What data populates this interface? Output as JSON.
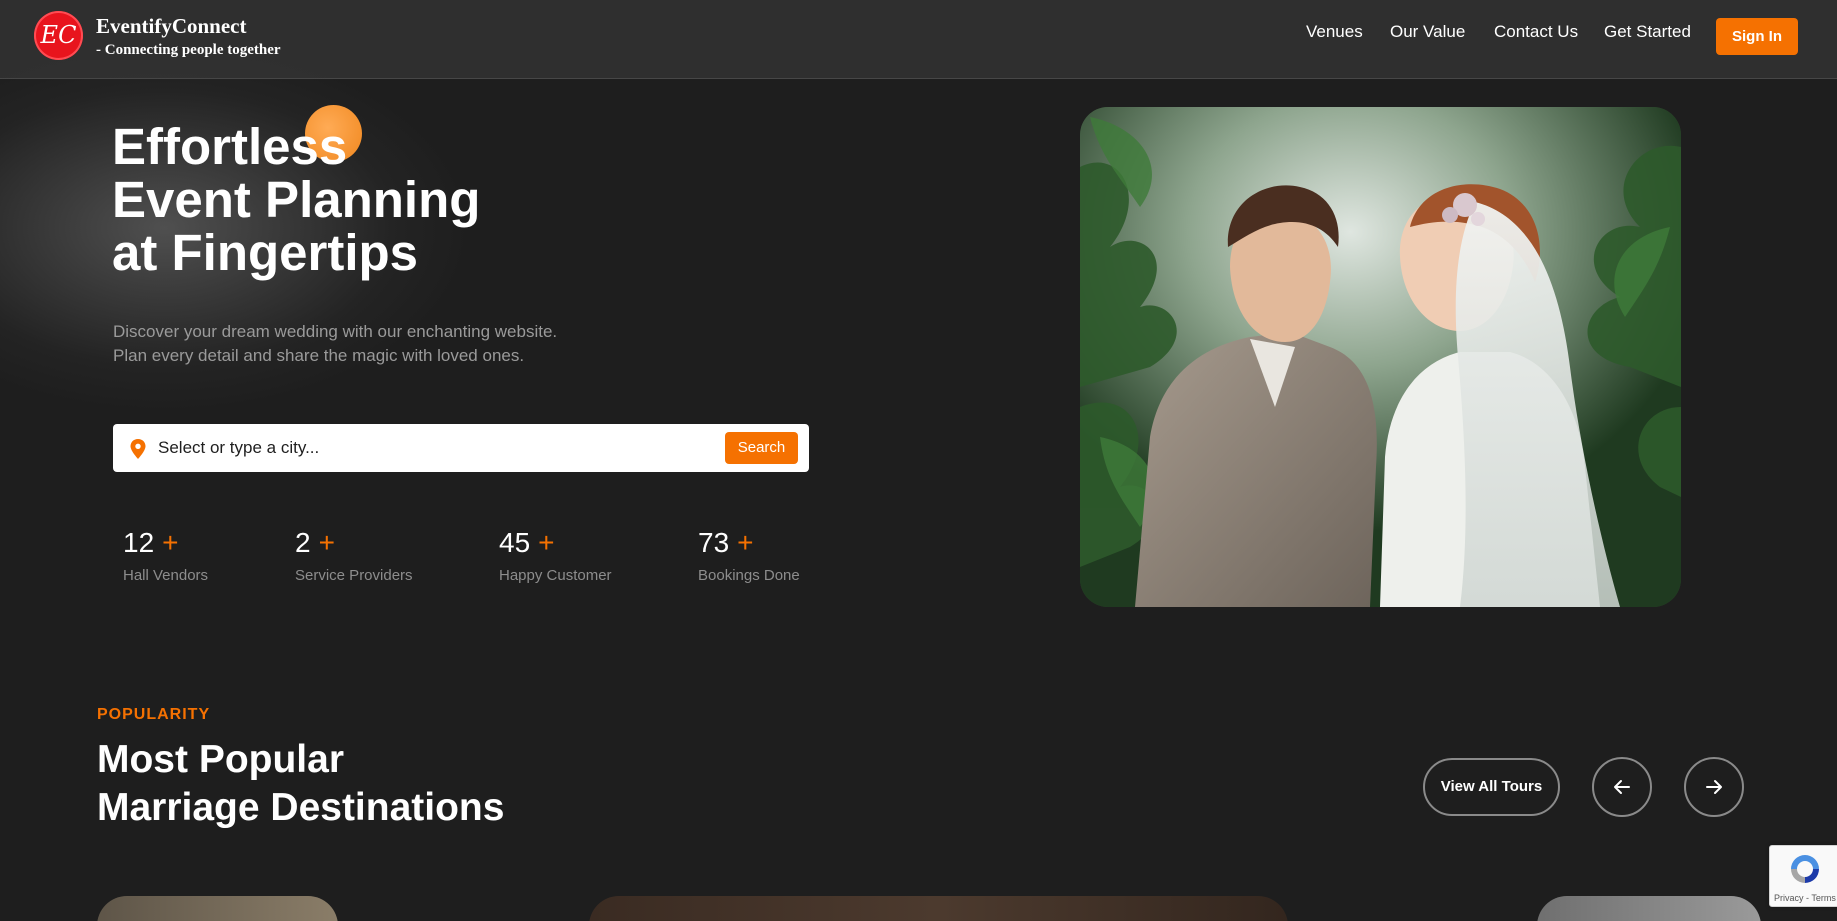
{
  "brand": {
    "monogram": "EC",
    "name": "EventifyConnect",
    "tagline": "- Connecting people together"
  },
  "nav": {
    "links": [
      "Venues",
      "Our Value",
      "Contact Us",
      "Get Started"
    ],
    "signin_label": "Sign In"
  },
  "hero": {
    "title_lines": [
      "Effortless",
      "Event Planning",
      "at Fingertips"
    ],
    "subtitle_lines": [
      "Discover your dream wedding with our enchanting website.",
      "Plan every detail and share the magic with loved ones."
    ],
    "search": {
      "placeholder": "Select or type a city...",
      "button_label": "Search"
    },
    "stats": [
      {
        "value": "12",
        "suffix": "+",
        "label": "Hall Vendors"
      },
      {
        "value": "2",
        "suffix": "+",
        "label": "Service Providers"
      },
      {
        "value": "45",
        "suffix": "+",
        "label": "Happy Customer"
      },
      {
        "value": "73",
        "suffix": "+",
        "label": "Bookings Done"
      }
    ],
    "image_icon": "wedding-couple-photo"
  },
  "popular": {
    "kicker": "POPULARITY",
    "title_lines": [
      "Most Popular",
      "Marriage Destinations"
    ],
    "view_all_label": "View All Tours",
    "prev_icon": "arrow-left-icon",
    "next_icon": "arrow-right-icon"
  },
  "recaptcha": {
    "links": "Privacy - Terms"
  },
  "colors": {
    "accent": "#f57101",
    "background": "#1e1e1e",
    "navbar": "#2f2f2f",
    "logo_red": "#e8141d"
  }
}
